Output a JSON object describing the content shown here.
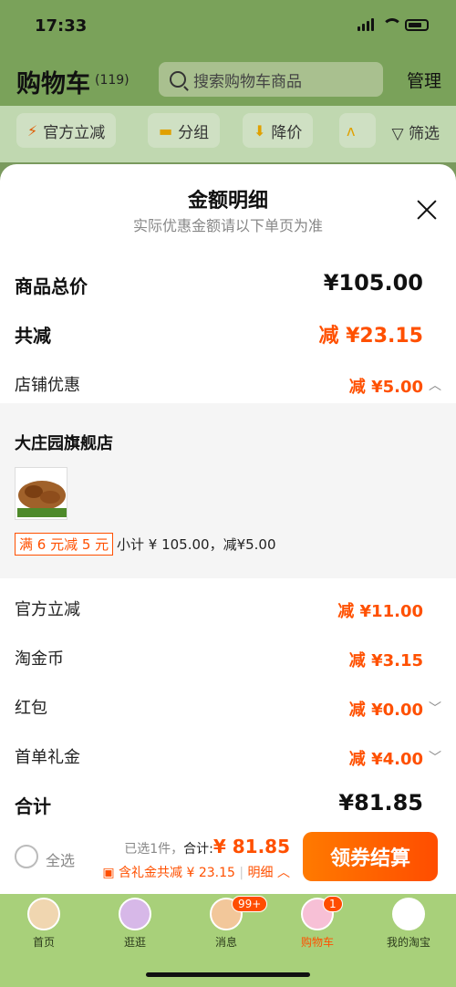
{
  "status_bar": {
    "time": "17:33"
  },
  "header": {
    "title": "购物车",
    "count": "(119)",
    "search_placeholder": "搜索购物车商品",
    "manage": "管理"
  },
  "filters": {
    "chips": [
      "官方立减",
      "分组",
      "降价"
    ],
    "filter_label": "筛选"
  },
  "sheet": {
    "title": "金额明细",
    "subtitle": "实际优惠金额请以下单页为准",
    "total_label": "商品总价",
    "total_value": "¥105.00",
    "reduce_label": "共减",
    "reduce_value": "减 ¥23.15",
    "store_label": "店铺优惠",
    "store_value": "减 ¥5.00",
    "shop": {
      "name": "大庄园旗舰店",
      "promo_tag": "满 6 元减 5 元",
      "subtotal": "小计 ¥ 105.00，减¥5.00"
    },
    "official_label": "官方立减",
    "official_value": "减 ¥11.00",
    "coin_label": "淘金币",
    "coin_value": "减 ¥3.15",
    "redpack_label": "红包",
    "redpack_value": "减 ¥0.00",
    "firstgift_label": "首单礼金",
    "firstgift_value": "减 ¥4.00",
    "sum_label": "合计",
    "sum_value": "¥81.85"
  },
  "checkout": {
    "select_all": "全选",
    "selected_text": "已选1件，",
    "total_text": "合计:",
    "total_amount": "¥ 81.85",
    "gift_text": "含礼金共减 ¥ 23.15",
    "detail_text": "明细",
    "pay_button": "领券结算"
  },
  "tabbar": {
    "tabs": [
      {
        "label": "首页"
      },
      {
        "label": "逛逛"
      },
      {
        "label": "消息",
        "badge": "99+"
      },
      {
        "label": "购物车",
        "badge": "1"
      },
      {
        "label": "我的淘宝"
      }
    ]
  },
  "colors": {
    "accent": "#ff5000",
    "header_bg": "#7aa25a"
  }
}
